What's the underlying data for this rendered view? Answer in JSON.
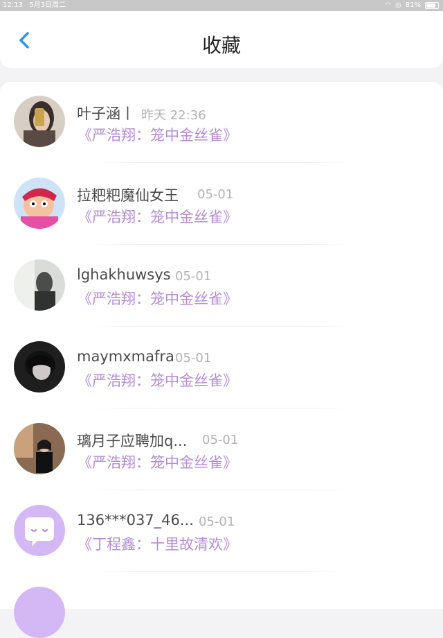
{
  "status_bar": {
    "time": "12:13",
    "date": "5月3日周二",
    "battery": "81%"
  },
  "header": {
    "title": "收藏"
  },
  "items": [
    {
      "name": "叶子涵丨",
      "date": "昨天 22:36",
      "work": "《严浩翔：笼中金丝雀》"
    },
    {
      "name": "拉粑粑魔仙女王",
      "date": "05-01",
      "work": "《严浩翔：笼中金丝雀》"
    },
    {
      "name": "lghakhuwsys",
      "date": "05-01",
      "work": "《严浩翔：笼中金丝雀》"
    },
    {
      "name": "maymxmafra",
      "date": "05-01",
      "work": "《严浩翔：笼中金丝雀》"
    },
    {
      "name": "璃月子应聘加q...",
      "date": "05-01",
      "work": "《严浩翔：笼中金丝雀》"
    },
    {
      "name": "136***037_46...",
      "date": "05-01",
      "work": "《丁程鑫：十里故清欢》"
    }
  ],
  "colors": {
    "accent": "#2196f3",
    "work_text": "#b58cd9",
    "avatar_default": "#d3b8f5"
  }
}
